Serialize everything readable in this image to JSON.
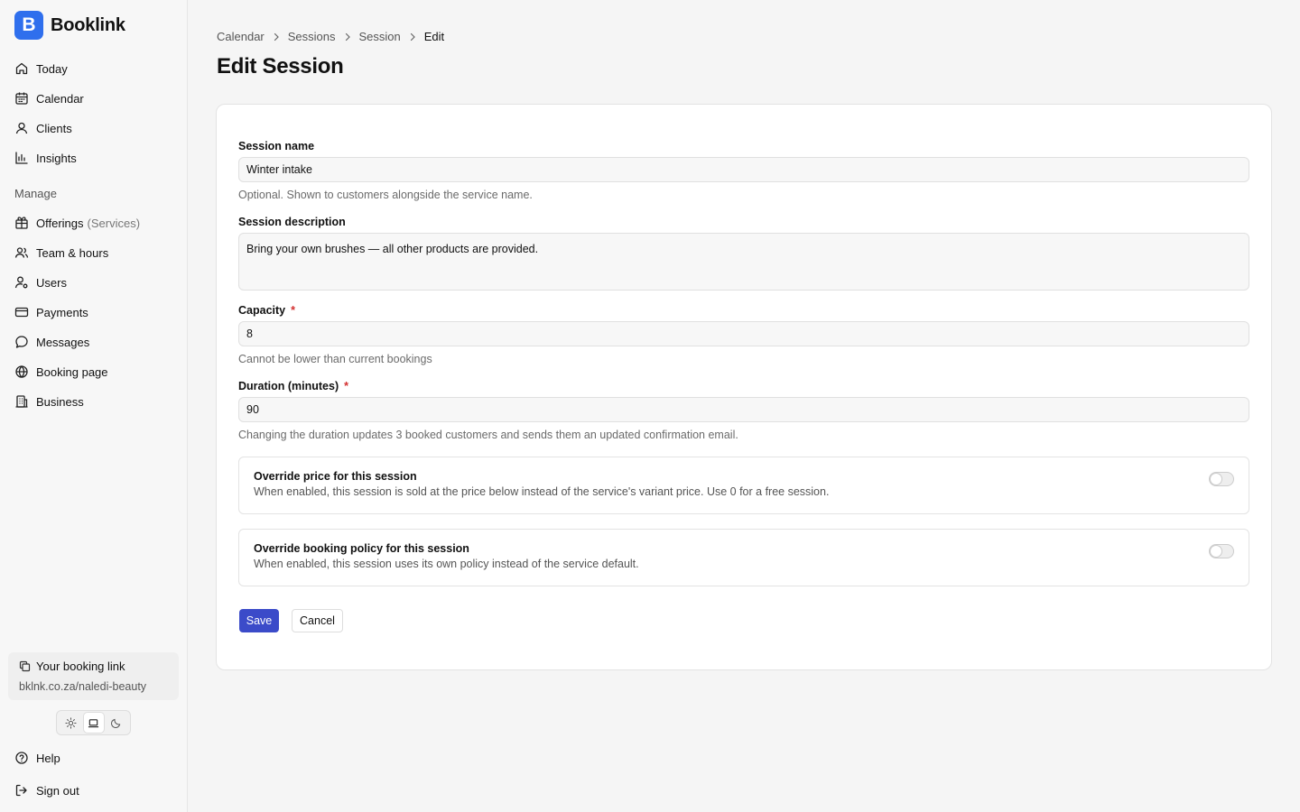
{
  "app": {
    "name": "Booklink",
    "logo_letter": "B",
    "brand_color": "#2f6fed",
    "accent_color": "#3b4bc9"
  },
  "sidebar": {
    "main_items": [
      {
        "label": "Today",
        "icon": "home-icon"
      },
      {
        "label": "Calendar",
        "icon": "calendar-icon"
      },
      {
        "label": "Clients",
        "icon": "user-icon"
      },
      {
        "label": "Insights",
        "icon": "chart-icon"
      }
    ],
    "manage_label": "Manage",
    "manage_items": [
      {
        "label": "Offerings",
        "suffix": "(Services)",
        "icon": "gift-icon"
      },
      {
        "label": "Team & hours",
        "icon": "users-icon"
      },
      {
        "label": "Users",
        "icon": "user-cog-icon"
      },
      {
        "label": "Payments",
        "icon": "credit-card-icon"
      },
      {
        "label": "Messages",
        "icon": "message-icon"
      },
      {
        "label": "Booking page",
        "icon": "globe-icon"
      },
      {
        "label": "Business",
        "icon": "building-icon"
      }
    ],
    "booking_link": {
      "title": "Your booking link",
      "url": "bklnk.co.za/naledi-beauty"
    },
    "theme": {
      "options": [
        "light",
        "system",
        "dark"
      ],
      "selected": "system"
    },
    "footer_items": [
      {
        "label": "Help",
        "icon": "help-icon"
      },
      {
        "label": "Sign out",
        "icon": "sign-out-icon"
      }
    ]
  },
  "breadcrumb": [
    "Calendar",
    "Sessions",
    "Session",
    "Edit"
  ],
  "page_title": "Edit Session",
  "form": {
    "session_name": {
      "label": "Session name",
      "value": "Winter intake",
      "hint": "Optional. Shown to customers alongside the service name."
    },
    "session_description": {
      "label": "Session description",
      "value": "Bring your own brushes — all other products are provided."
    },
    "capacity": {
      "label": "Capacity",
      "required_mark": "*",
      "value": "8",
      "hint": "Cannot be lower than current bookings"
    },
    "duration": {
      "label": "Duration (minutes)",
      "required_mark": "*",
      "value": "90",
      "hint": "Changing the duration updates 3 booked customers and sends them an updated confirmation email."
    },
    "override_price": {
      "title": "Override price for this session",
      "description": "When enabled, this session is sold at the price below instead of the service's variant price. Use 0 for a free session.",
      "enabled": false
    },
    "override_policy": {
      "title": "Override booking policy for this session",
      "description": "When enabled, this session uses its own policy instead of the service default.",
      "enabled": false
    },
    "save_label": "Save",
    "cancel_label": "Cancel"
  }
}
